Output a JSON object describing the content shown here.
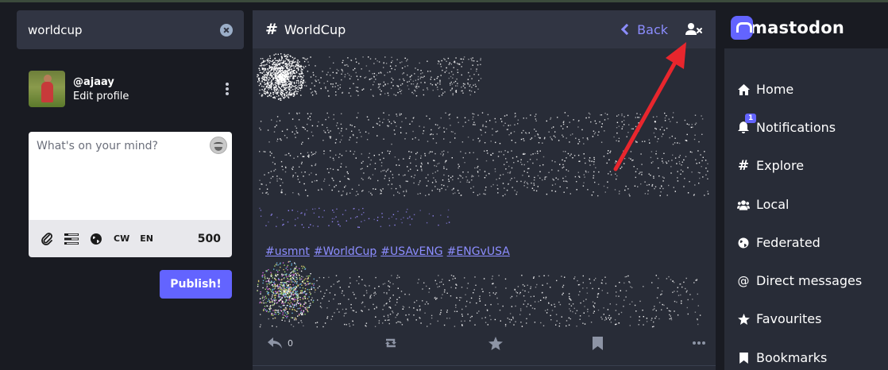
{
  "search": {
    "value": "worldcup"
  },
  "profile": {
    "handle": "@ajaay",
    "edit_label": "Edit profile"
  },
  "composer": {
    "placeholder": "What's on your mind?",
    "cw_label": "CW",
    "lang_label": "EN",
    "char_count": "500",
    "publish_label": "Publish!"
  },
  "column": {
    "title": "WorldCup",
    "back_label": "Back"
  },
  "post": {
    "hashtags": [
      "#usmnt",
      "#WorldCup",
      "#USAvENG",
      "#ENGvUSA"
    ],
    "reply_count": "0"
  },
  "brand": {
    "name": "mastodon"
  },
  "nav": {
    "items": [
      {
        "label": "Home",
        "icon": "home-icon"
      },
      {
        "label": "Notifications",
        "icon": "bell-icon",
        "badge": "1"
      },
      {
        "label": "Explore",
        "icon": "hash-icon"
      },
      {
        "label": "Local",
        "icon": "users-icon"
      },
      {
        "label": "Federated",
        "icon": "globe-icon"
      },
      {
        "label": "Direct messages",
        "icon": "at-icon"
      },
      {
        "label": "Favourites",
        "icon": "star-icon"
      },
      {
        "label": "Bookmarks",
        "icon": "bookmark-icon"
      }
    ]
  },
  "colors": {
    "background": "#191b22",
    "panel": "#282c37",
    "header": "#313543",
    "accent": "#6364ff",
    "link": "#8c8dff",
    "arrow": "#e8262d"
  }
}
